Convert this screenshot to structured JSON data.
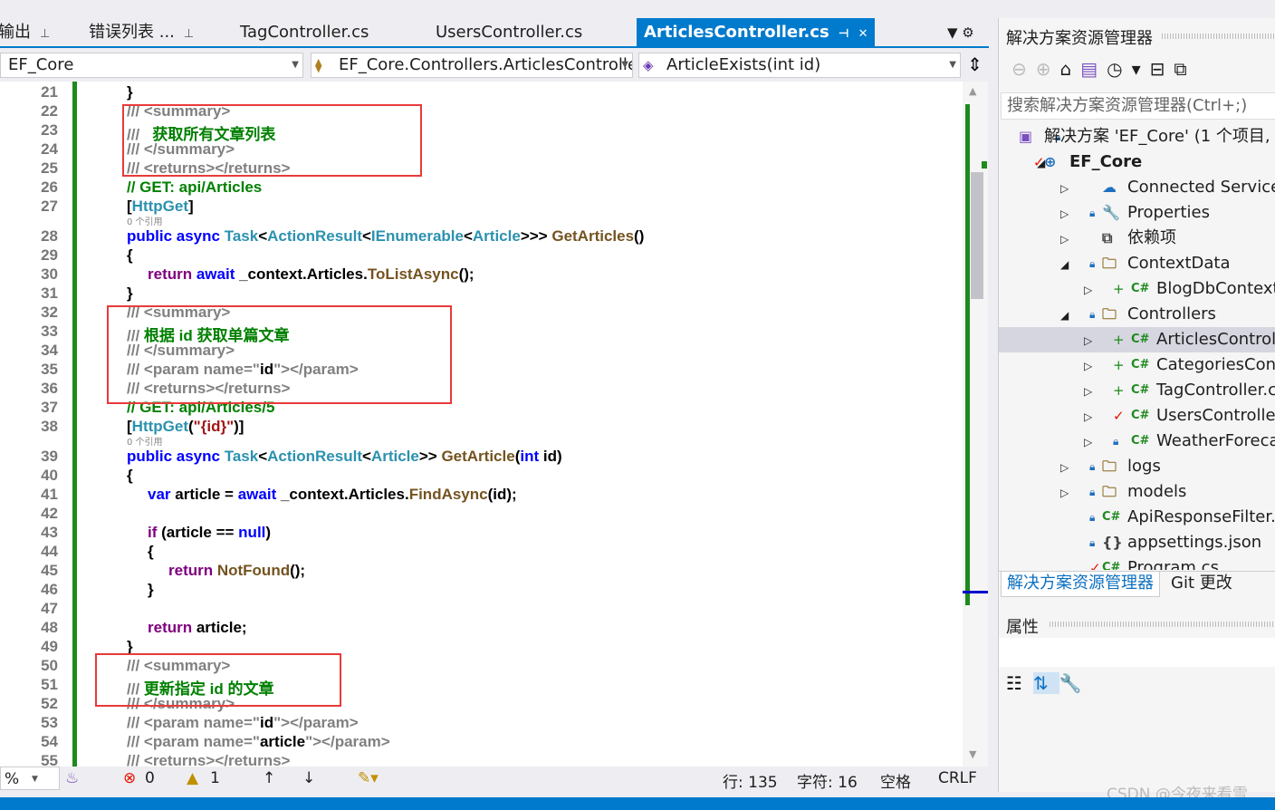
{
  "tabs": [
    {
      "label": "输出",
      "pin": "⊥"
    },
    {
      "label": "错误列表 ...",
      "pin": "⊥"
    },
    {
      "label": "TagController.cs"
    },
    {
      "label": "UsersController.cs"
    },
    {
      "label": "ArticlesController.cs",
      "active": true,
      "pin": "⊣",
      "close": "✕"
    }
  ],
  "nav": {
    "project": "EF_Core",
    "class": "EF_Core.Controllers.ArticlesControlle",
    "member": "ArticleExists(int id)"
  },
  "code_lens": "0 个引用",
  "lines": [
    {
      "n": "21",
      "i": 0,
      "t": [
        [
          "",
          "}"
        ]
      ]
    },
    {
      "n": "22",
      "i": 0,
      "t": [
        [
          "d",
          "/// <summary>"
        ]
      ]
    },
    {
      "n": "23",
      "i": 0,
      "t": [
        [
          "d",
          "///   "
        ],
        [
          "g",
          "获取所有文章列表"
        ]
      ]
    },
    {
      "n": "24",
      "i": 0,
      "t": [
        [
          "d",
          "/// </summary>"
        ]
      ]
    },
    {
      "n": "25",
      "i": 0,
      "t": [
        [
          "d",
          "/// <returns></returns>"
        ]
      ]
    },
    {
      "n": "26",
      "i": 0,
      "t": [
        [
          "g",
          "// GET: api/Articles"
        ]
      ]
    },
    {
      "n": "27",
      "i": 0,
      "t": [
        [
          "",
          "["
        ],
        [
          "t",
          "HttpGet"
        ],
        [
          "",
          "]"
        ]
      ],
      "lens": true
    },
    {
      "n": "28",
      "i": 0,
      "t": [
        [
          "k",
          "public async "
        ],
        [
          "t",
          "Task"
        ],
        [
          "",
          "<"
        ],
        [
          "t",
          "ActionResult"
        ],
        [
          "",
          "<"
        ],
        [
          "t",
          "IEnumerable"
        ],
        [
          "",
          "<"
        ],
        [
          "t",
          "Article"
        ],
        [
          "",
          ">>> "
        ],
        [
          "m",
          "GetArticles"
        ],
        [
          "",
          "()"
        ]
      ]
    },
    {
      "n": "29",
      "i": 0,
      "t": [
        [
          "",
          "{"
        ]
      ]
    },
    {
      "n": "30",
      "i": 1,
      "t": [
        [
          "c",
          "return "
        ],
        [
          "k",
          "await "
        ],
        [
          "",
          "_context.Articles."
        ],
        [
          "m",
          "ToListAsync"
        ],
        [
          "",
          "();"
        ]
      ]
    },
    {
      "n": "31",
      "i": 0,
      "t": [
        [
          "",
          "}"
        ]
      ]
    },
    {
      "n": "32",
      "i": 0,
      "t": [
        [
          "d",
          "/// <summary>"
        ]
      ]
    },
    {
      "n": "33",
      "i": 0,
      "t": [
        [
          "d",
          "/// "
        ],
        [
          "g",
          "根据 id 获取单篇文章"
        ]
      ]
    },
    {
      "n": "34",
      "i": 0,
      "t": [
        [
          "d",
          "/// </summary>"
        ]
      ]
    },
    {
      "n": "35",
      "i": 0,
      "t": [
        [
          "d",
          "/// <param name=\""
        ],
        [
          "",
          "id"
        ],
        [
          "d",
          "\"></param>"
        ]
      ]
    },
    {
      "n": "36",
      "i": 0,
      "t": [
        [
          "d",
          "/// <returns></returns>"
        ]
      ]
    },
    {
      "n": "37",
      "i": 0,
      "t": [
        [
          "g",
          "// GET: api/Articles/5"
        ]
      ]
    },
    {
      "n": "38",
      "i": 0,
      "t": [
        [
          "",
          "["
        ],
        [
          "t",
          "HttpGet"
        ],
        [
          "",
          "("
        ],
        [
          "s",
          "\"{id}\""
        ],
        [
          "",
          ")]"
        ]
      ],
      "lens": true
    },
    {
      "n": "39",
      "i": 0,
      "t": [
        [
          "k",
          "public async "
        ],
        [
          "t",
          "Task"
        ],
        [
          "",
          "<"
        ],
        [
          "t",
          "ActionResult"
        ],
        [
          "",
          "<"
        ],
        [
          "t",
          "Article"
        ],
        [
          "",
          ">> "
        ],
        [
          "m",
          "GetArticle"
        ],
        [
          "",
          "("
        ],
        [
          "k",
          "int "
        ],
        [
          "",
          "id)"
        ]
      ]
    },
    {
      "n": "40",
      "i": 0,
      "t": [
        [
          "",
          "{"
        ]
      ]
    },
    {
      "n": "41",
      "i": 1,
      "t": [
        [
          "k",
          "var "
        ],
        [
          "",
          "article = "
        ],
        [
          "k",
          "await "
        ],
        [
          "",
          "_context.Articles."
        ],
        [
          "m",
          "FindAsync"
        ],
        [
          "",
          "(id);"
        ]
      ]
    },
    {
      "n": "42",
      "i": 1,
      "t": []
    },
    {
      "n": "43",
      "i": 1,
      "t": [
        [
          "c",
          "if "
        ],
        [
          "",
          "(article == "
        ],
        [
          "k",
          "null"
        ],
        [
          "",
          ")"
        ]
      ]
    },
    {
      "n": "44",
      "i": 1,
      "t": [
        [
          "",
          "{"
        ]
      ]
    },
    {
      "n": "45",
      "i": 2,
      "t": [
        [
          "c",
          "return "
        ],
        [
          "m",
          "NotFound"
        ],
        [
          "",
          "();"
        ]
      ]
    },
    {
      "n": "46",
      "i": 1,
      "t": [
        [
          "",
          "}"
        ]
      ]
    },
    {
      "n": "47",
      "i": 1,
      "t": []
    },
    {
      "n": "48",
      "i": 1,
      "t": [
        [
          "c",
          "return "
        ],
        [
          "",
          "article;"
        ]
      ]
    },
    {
      "n": "49",
      "i": 0,
      "t": [
        [
          "",
          "}"
        ]
      ]
    },
    {
      "n": "50",
      "i": 0,
      "t": [
        [
          "d",
          "/// <summary>"
        ]
      ]
    },
    {
      "n": "51",
      "i": 0,
      "t": [
        [
          "d",
          "/// "
        ],
        [
          "g",
          "更新指定 id 的文章"
        ]
      ]
    },
    {
      "n": "52",
      "i": 0,
      "t": [
        [
          "d",
          "/// </summary>"
        ]
      ]
    },
    {
      "n": "53",
      "i": 0,
      "t": [
        [
          "d",
          "/// <param name=\""
        ],
        [
          "",
          "id"
        ],
        [
          "d",
          "\"></param>"
        ]
      ]
    },
    {
      "n": "54",
      "i": 0,
      "t": [
        [
          "d",
          "/// <param name=\""
        ],
        [
          "",
          "article"
        ],
        [
          "d",
          "\"></param>"
        ]
      ]
    },
    {
      "n": "55",
      "i": 0,
      "t": [
        [
          "d",
          "/// <returns></returns>"
        ]
      ]
    }
  ],
  "status": {
    "zoom": "%",
    "errors": "0",
    "warnings": "1",
    "line": "行: 135",
    "char": "字符: 16",
    "spaces": "空格",
    "eol": "CRLF"
  },
  "solution_explorer": {
    "title": "解决方案资源管理器",
    "search_placeholder": "搜索解决方案资源管理器(Ctrl+;)",
    "items": [
      {
        "label": "解决方案 'EF_Core' (1 个项目,",
        "level": 0,
        "icon": "solution-icon",
        "lock": true
      },
      {
        "label": "EF_Core",
        "level": 1,
        "expanded": true,
        "icon": "web-project-icon",
        "bold": true,
        "check": true
      },
      {
        "label": "Connected Services",
        "level": 2,
        "icon": "connected-services-icon"
      },
      {
        "label": "Properties",
        "level": 2,
        "icon": "properties-icon",
        "lock": true
      },
      {
        "label": "依赖项",
        "level": 2,
        "icon": "dependencies-icon"
      },
      {
        "label": "ContextData",
        "level": 2,
        "expanded": true,
        "icon": "folder-icon",
        "lock": true
      },
      {
        "label": "BlogDbContext.cs",
        "level": 3,
        "icon": "csharp-icon",
        "plus": true
      },
      {
        "label": "Controllers",
        "level": 2,
        "expanded": true,
        "icon": "folder-icon",
        "lock": true
      },
      {
        "label": "ArticlesController.cs",
        "level": 3,
        "icon": "csharp-icon",
        "plus": true,
        "selected": true
      },
      {
        "label": "CategoriesController.cs",
        "level": 3,
        "icon": "csharp-icon",
        "plus": true
      },
      {
        "label": "TagController.cs",
        "level": 3,
        "icon": "csharp-icon",
        "plus": true
      },
      {
        "label": "UsersController.cs",
        "level": 3,
        "icon": "csharp-icon",
        "check": true
      },
      {
        "label": "WeatherForecastController.cs",
        "level": 3,
        "icon": "csharp-icon",
        "lock": true
      },
      {
        "label": "logs",
        "level": 2,
        "icon": "folder-icon",
        "lock": true
      },
      {
        "label": "models",
        "level": 2,
        "icon": "folder-icon",
        "lock": true
      },
      {
        "label": "ApiResponseFilter.cs",
        "level": 2,
        "icon": "csharp-icon",
        "lock": true
      },
      {
        "label": "appsettings.json",
        "level": 2,
        "icon": "json-icon",
        "lock": true
      },
      {
        "label": "Program.cs",
        "level": 2,
        "icon": "csharp-icon",
        "check": true
      }
    ],
    "bottom_tabs": [
      "解决方案资源管理器",
      "Git 更改"
    ]
  },
  "properties": {
    "title": "属性"
  },
  "watermark": "CSDN @今夜来看雪",
  "colors": {
    "accent": "#007acc",
    "keyword": "#0000ff",
    "control": "#800080",
    "type": "#2b91af",
    "method": "#74531f",
    "comment": "#008000",
    "doc": "#808080",
    "string": "#a31515",
    "highlight": "#e83a3a"
  }
}
